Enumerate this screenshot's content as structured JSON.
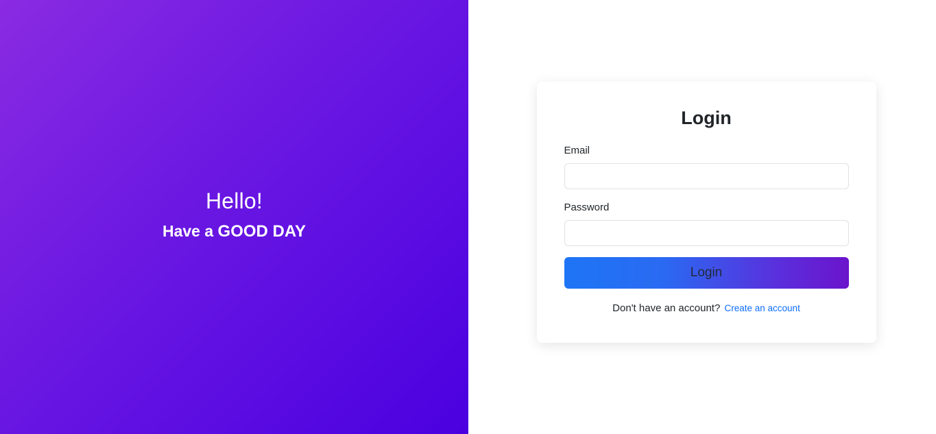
{
  "hero": {
    "greeting": "Hello!",
    "subtitle_prefix": "Have a ",
    "subtitle_emphasis": "GOOD DAY"
  },
  "login_form": {
    "title": "Login",
    "email_label": "Email",
    "email_value": "",
    "password_label": "Password",
    "password_value": "",
    "submit_label": "Login",
    "signup_prompt": "Don't have an account?",
    "signup_link_label": "Create an account"
  },
  "colors": {
    "hero_gradient_start": "#8a2be2",
    "hero_gradient_end": "#4a00e0",
    "button_gradient_start": "#1e75f5",
    "button_gradient_end": "#6b14cc",
    "link": "#0d6efd"
  }
}
